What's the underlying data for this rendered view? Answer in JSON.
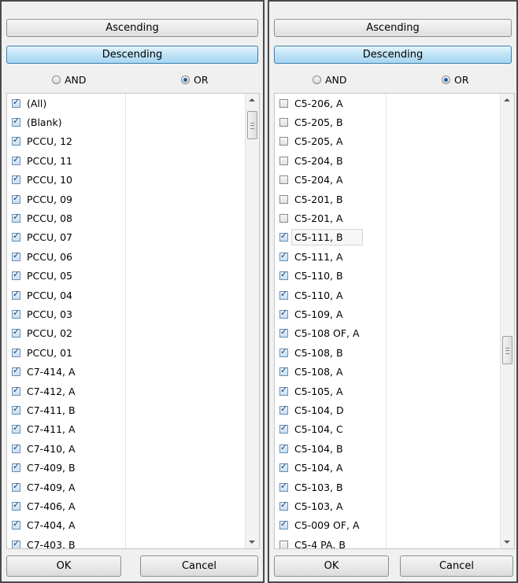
{
  "left": {
    "sort_asc": "Ascending",
    "sort_desc": "Descending",
    "and_label": "AND",
    "or_label": "OR",
    "selected_operator": "OR",
    "items": [
      {
        "label": "(All)",
        "checked": true
      },
      {
        "label": "(Blank)",
        "checked": true
      },
      {
        "label": "PCCU, 12",
        "checked": true
      },
      {
        "label": "PCCU, 11",
        "checked": true
      },
      {
        "label": "PCCU, 10",
        "checked": true
      },
      {
        "label": "PCCU, 09",
        "checked": true
      },
      {
        "label": "PCCU, 08",
        "checked": true
      },
      {
        "label": "PCCU, 07",
        "checked": true
      },
      {
        "label": "PCCU, 06",
        "checked": true
      },
      {
        "label": "PCCU, 05",
        "checked": true
      },
      {
        "label": "PCCU, 04",
        "checked": true
      },
      {
        "label": "PCCU, 03",
        "checked": true
      },
      {
        "label": "PCCU, 02",
        "checked": true
      },
      {
        "label": "PCCU, 01",
        "checked": true
      },
      {
        "label": "C7-414, A",
        "checked": true
      },
      {
        "label": "C7-412, A",
        "checked": true
      },
      {
        "label": "C7-411, B",
        "checked": true
      },
      {
        "label": "C7-411, A",
        "checked": true
      },
      {
        "label": "C7-410, A",
        "checked": true
      },
      {
        "label": "C7-409, B",
        "checked": true
      },
      {
        "label": "C7-409, A",
        "checked": true
      },
      {
        "label": "C7-406, A",
        "checked": true
      },
      {
        "label": "C7-404, A",
        "checked": true
      },
      {
        "label": "C7-403, B",
        "checked": true
      }
    ],
    "ok_label": "OK",
    "cancel_label": "Cancel"
  },
  "right": {
    "sort_asc": "Ascending",
    "sort_desc": "Descending",
    "and_label": "AND",
    "or_label": "OR",
    "selected_operator": "OR",
    "items": [
      {
        "label": "C5-206, A",
        "checked": false
      },
      {
        "label": "C5-205, B",
        "checked": false
      },
      {
        "label": "C5-205, A",
        "checked": false
      },
      {
        "label": "C5-204, B",
        "checked": false
      },
      {
        "label": "C5-204, A",
        "checked": false
      },
      {
        "label": "C5-201, B",
        "checked": false
      },
      {
        "label": "C5-201, A",
        "checked": false
      },
      {
        "label": "C5-111, B",
        "checked": true,
        "highlighted": true
      },
      {
        "label": "C5-111, A",
        "checked": true
      },
      {
        "label": "C5-110, B",
        "checked": true
      },
      {
        "label": "C5-110, A",
        "checked": true
      },
      {
        "label": "C5-109, A",
        "checked": true
      },
      {
        "label": "C5-108 OF, A",
        "checked": true
      },
      {
        "label": "C5-108, B",
        "checked": true
      },
      {
        "label": "C5-108, A",
        "checked": true
      },
      {
        "label": "C5-105, A",
        "checked": true
      },
      {
        "label": "C5-104, D",
        "checked": true
      },
      {
        "label": "C5-104, C",
        "checked": true
      },
      {
        "label": "C5-104, B",
        "checked": true
      },
      {
        "label": "C5-104, A",
        "checked": true
      },
      {
        "label": "C5-103, B",
        "checked": true
      },
      {
        "label": "C5-103, A",
        "checked": true
      },
      {
        "label": "C5-009 OF, A",
        "checked": true
      },
      {
        "label": "C5-4 PA, B",
        "checked": false
      }
    ],
    "ok_label": "OK",
    "cancel_label": "Cancel"
  }
}
